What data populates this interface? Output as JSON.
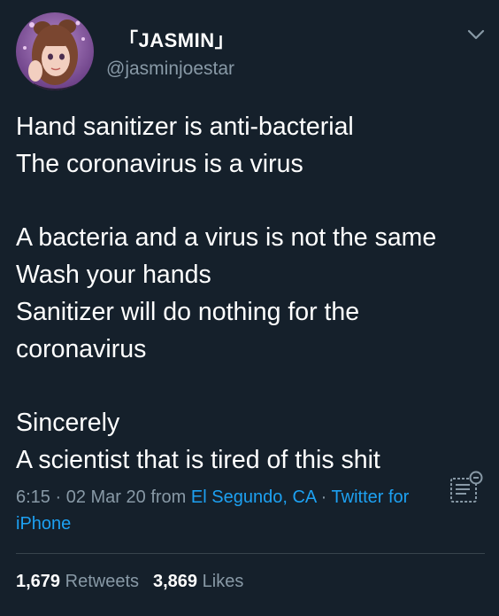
{
  "tweet": {
    "author": {
      "display_name": "「JASMIN」",
      "handle": "@jasminjoestar"
    },
    "lines": [
      "Hand sanitizer is anti-bacterial",
      "The coronavirus is a virus",
      "",
      "A bacteria and a virus is not the same",
      "Wash your hands",
      "Sanitizer will do nothing for the",
      "coronavirus",
      "",
      "Sincerely",
      "A scientist that is tired of this shit"
    ],
    "meta": {
      "time": "6:15",
      "separator": " · ",
      "date": "02 Mar 20",
      "from_word": " from ",
      "location": "El Segundo, CA",
      "client": "Twitter for iPhone"
    },
    "stats": {
      "retweets_count": "1,679",
      "retweets_label": "Retweets",
      "likes_count": "3,869",
      "likes_label": "Likes"
    }
  },
  "icons": {
    "menu": "chevron-down-icon",
    "translate": "translate-icon"
  },
  "colors": {
    "background": "#15202b",
    "text": "#ffffff",
    "secondary": "#8899a6",
    "link": "#1da1f2",
    "divider": "#38444d"
  }
}
